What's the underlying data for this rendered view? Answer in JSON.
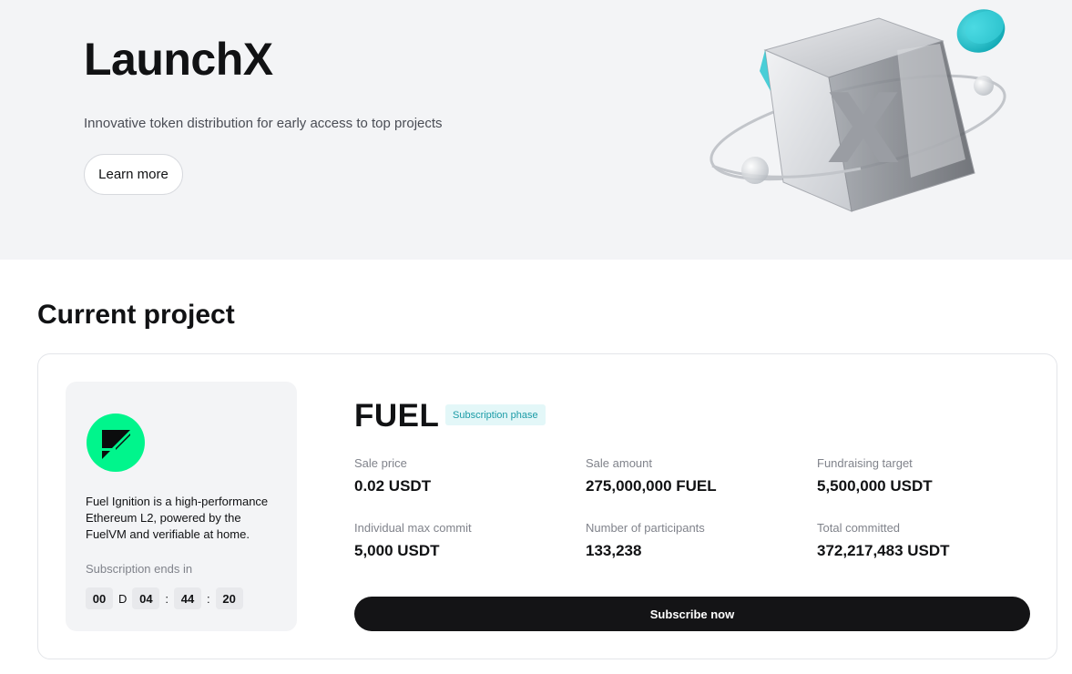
{
  "hero": {
    "title": "LaunchX",
    "subtitle": "Innovative token distribution for early access to top projects",
    "learn_more_label": "Learn more",
    "art_letter": "X"
  },
  "current_project": {
    "section_title": "Current project",
    "description": "Fuel Ignition is a high-performance Ethereum L2, powered by the FuelVM and verifiable at home.",
    "ends_label": "Subscription ends in",
    "countdown": {
      "days": "00",
      "day_unit": "D",
      "hours": "04",
      "minutes": "44",
      "seconds": "20",
      "separator": ":"
    },
    "name": "FUEL",
    "phase": "Subscription phase",
    "stats": [
      {
        "label": "Sale price",
        "value": "0.02 USDT"
      },
      {
        "label": "Sale amount",
        "value": "275,000,000 FUEL"
      },
      {
        "label": "Fundraising target",
        "value": "5,500,000 USDT"
      },
      {
        "label": "Individual max commit",
        "value": "5,000 USDT"
      },
      {
        "label": "Number of participants",
        "value": "133,238"
      },
      {
        "label": "Total committed",
        "value": "372,217,483 USDT"
      }
    ],
    "subscribe_label": "Subscribe now"
  },
  "colors": {
    "logo_green": "#00f58c",
    "badge_bg": "#e3f7f8",
    "badge_text": "#1a9ba6",
    "button_dark": "#141416",
    "coin_teal": "#1fc4cf"
  }
}
